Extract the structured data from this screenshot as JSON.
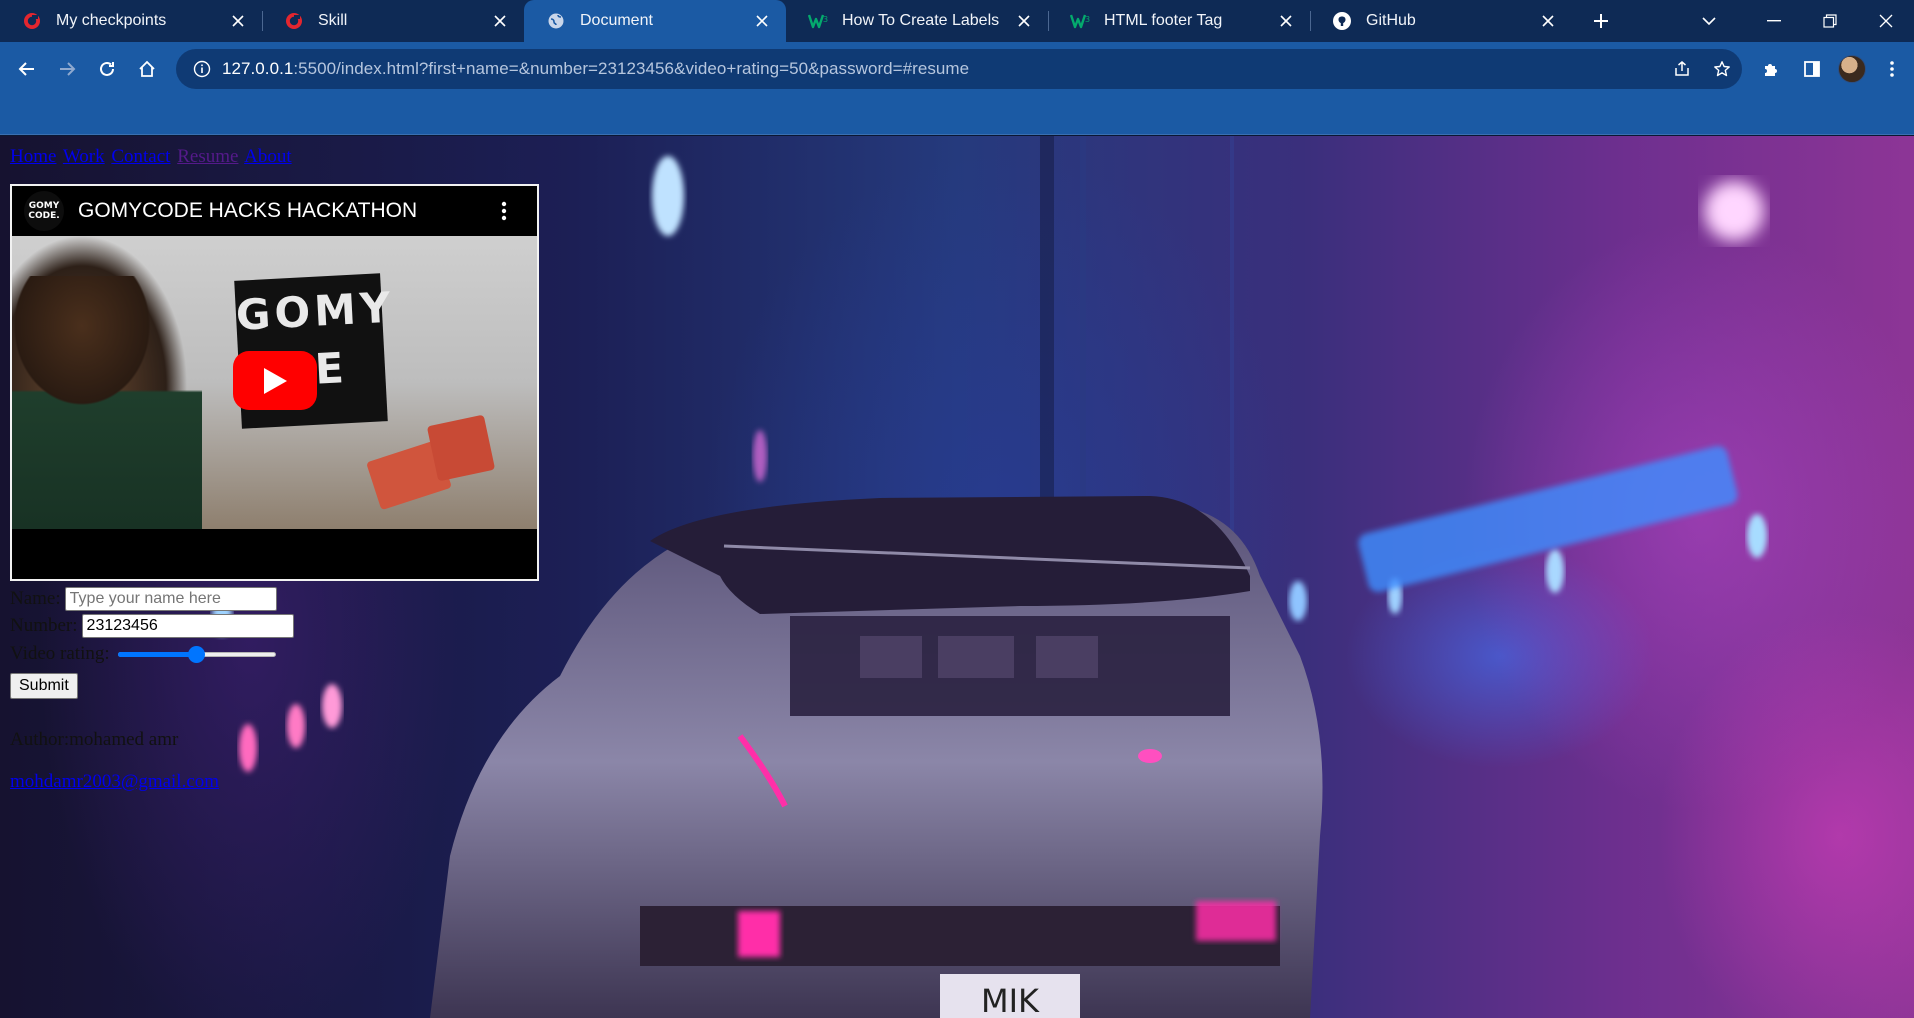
{
  "browser": {
    "tabs": [
      {
        "title": "My checkpoints",
        "favicon": "gomycode-icon",
        "active": false
      },
      {
        "title": "Skill",
        "favicon": "gomycode-icon",
        "active": false
      },
      {
        "title": "Document",
        "favicon": "globe-icon",
        "active": true
      },
      {
        "title": "How To Create Labels",
        "favicon": "w3schools-icon",
        "active": false
      },
      {
        "title": "HTML footer Tag",
        "favicon": "w3schools-icon",
        "active": false
      },
      {
        "title": "GitHub",
        "favicon": "github-icon",
        "active": false
      }
    ],
    "url_host": "127.0.0.1",
    "url_rest": ":5500/index.html?first+name=&number=23123456&video+rating=50&password=#resume"
  },
  "page": {
    "nav": [
      {
        "label": "Home",
        "visited": false
      },
      {
        "label": "Work",
        "visited": false
      },
      {
        "label": "Contact",
        "visited": false
      },
      {
        "label": "Resume",
        "visited": true
      },
      {
        "label": "About",
        "visited": false
      }
    ],
    "video": {
      "title": "GOMYCODE HACKS HACKATHON",
      "channel_logo_text": "GOMY CODE.",
      "sign_text_line1": "GOMY",
      "sign_text_line2": "DE"
    },
    "form": {
      "name_label": "Name:",
      "name_placeholder": "Type your name here",
      "name_value": "",
      "number_label": "Number:",
      "number_value": "23123456",
      "rating_label": "Video rating:",
      "rating_value": 50,
      "rating_min": 0,
      "rating_max": 100,
      "submit_label": "Submit"
    },
    "footer": {
      "author": "Author:mohamed amr",
      "email": "mohdamr2003@gmail.com"
    },
    "background_plate_text": "MIK"
  },
  "colors": {
    "tab_bar": "#0e2a55",
    "toolbar": "#1b5aa4",
    "omnibox": "#0f3a74",
    "link": "#0000ee",
    "visited_link": "#551a8b",
    "youtube_red": "#ff0000",
    "range_accent": "#0075ff"
  }
}
